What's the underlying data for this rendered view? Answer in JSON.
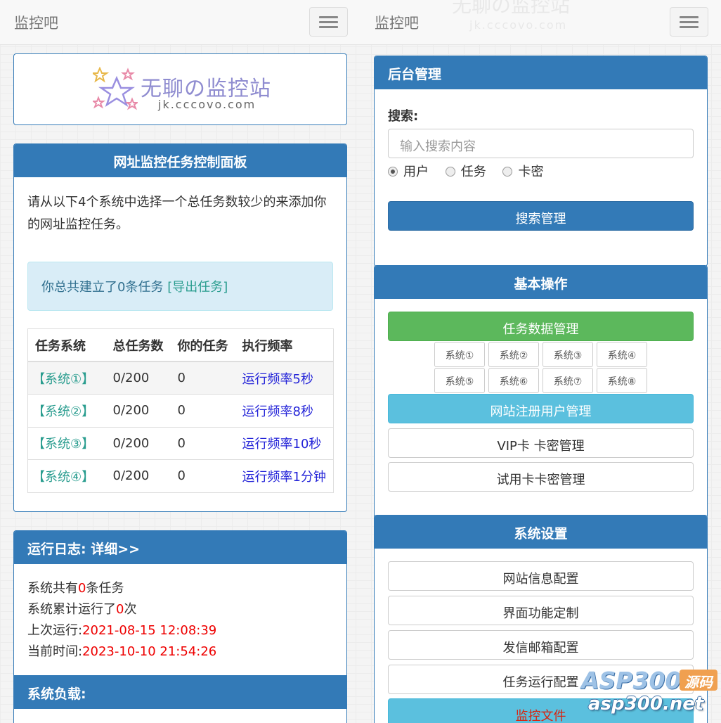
{
  "brand": "监控吧",
  "logo": {
    "title": "无聊の监控站",
    "subtitle": "jk.cccovo.com"
  },
  "control_panel": {
    "title": "网址监控任务控制面板",
    "intro": "请从以下4个系统中选择一个总任务数较少的来添加你的网址监控任务。",
    "alert_prefix": "你总共建立了0条任务 ",
    "alert_link": "[导出任务]",
    "columns": [
      "任务系统",
      "总任务数",
      "你的任务",
      "执行频率"
    ],
    "rows": [
      {
        "system": "【系统①】",
        "total": "0/200",
        "mine": "0",
        "freq": "运行频率5秒"
      },
      {
        "system": "【系统②】",
        "total": "0/200",
        "mine": "0",
        "freq": "运行频率8秒"
      },
      {
        "system": "【系统③】",
        "total": "0/200",
        "mine": "0",
        "freq": "运行频率10秒"
      },
      {
        "system": "【系统④】",
        "total": "0/200",
        "mine": "0",
        "freq": "运行频率1分钟"
      }
    ]
  },
  "log": {
    "title": "运行日志:  详细>>",
    "line1_a": "系统共有",
    "line1_n": "0",
    "line1_b": "条任务",
    "line2_a": "系统累计运行了",
    "line2_n": "0",
    "line2_b": "次",
    "line3_a": "上次运行:",
    "line3_v": "2021-08-15 12:08:39",
    "line4_a": "当前时间:",
    "line4_v": "2023-10-10 21:54:26"
  },
  "load": {
    "title": "系统负载:"
  },
  "admin": {
    "title": "后台管理",
    "search_label": "搜索:",
    "search_placeholder": "输入搜索内容",
    "radios": [
      "用户",
      "任务",
      "卡密"
    ],
    "search_button": "搜索管理"
  },
  "basic": {
    "title": "基本操作",
    "task_data": "任务数据管理",
    "systems": [
      "系统①",
      "系统②",
      "系统③",
      "系统④",
      "系统⑤",
      "系统⑥",
      "系统⑦",
      "系统⑧"
    ],
    "user_manage": "网站注册用户管理",
    "vip": "VIP卡 卡密管理",
    "trial": "试用卡卡密管理"
  },
  "settings": {
    "title": "系统设置",
    "items": [
      "网站信息配置",
      "界面功能定制",
      "发信邮箱配置",
      "任务运行配置"
    ],
    "monitor_file": "监控文件"
  },
  "watermark": {
    "line1": "ASP300",
    "badge": "源码",
    "line2": "asp300.net"
  },
  "colors": {
    "primary": "#337ab7",
    "success": "#5cb85c",
    "info": "#5bc0de",
    "red": "#e00000"
  }
}
